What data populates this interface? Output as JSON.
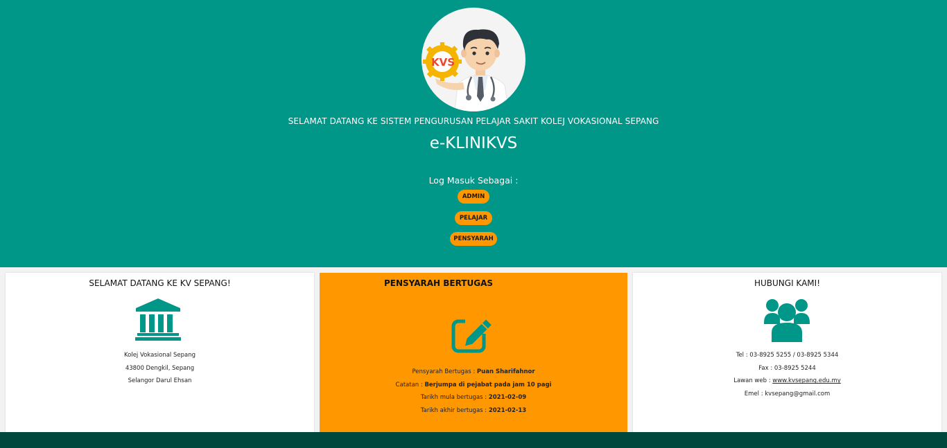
{
  "hero": {
    "tagline": "SELAMAT DATANG KE SISTEM PENGURUSAN PELAJAR SAKIT KOLEJ VOKASIONAL SEPANG",
    "title": "e-KLINIKVS",
    "login_label": "Log Masuk Sebagai :",
    "logo_text": "KVS",
    "roles": [
      "ADMIN",
      "PELAJAR",
      "PENSYARAH"
    ]
  },
  "card_left": {
    "title": "SELAMAT DATANG KE KV SEPANG!",
    "icon": "institution-icon",
    "lines": [
      "Kolej Vokasional Sepang",
      "43800 Dengkil, Sepang",
      "Selangor Darul Ehsan"
    ]
  },
  "card_mid": {
    "title": "PENSYARAH BERTUGAS",
    "icon": "edit-icon",
    "lecturer_label": "Pensyarah Bertugas : ",
    "lecturer_value": "Puan Sharifahnor",
    "note_label": "Catatan : ",
    "note_value": "Berjumpa di pejabat pada jam 10 pagi",
    "start_label": "Tarikh mula bertugas : ",
    "start_value": "2021-02-09",
    "end_label": "Tarikh akhir bertugas : ",
    "end_value": "2021-02-13"
  },
  "card_right": {
    "title": "HUBUNGI KAMI!",
    "icon": "users-icon",
    "tel": "Tel : 03-8925 5255 / 03-8925 5344",
    "fax": "Fax : 03-8925 5244",
    "web_label": "Lawan web : ",
    "web_link": "www.kvsepang.edu.my",
    "email": "Emel : kvsepang@gmail.com"
  },
  "colors": {
    "primary": "#009688",
    "accent": "#ff9800",
    "footer": "#00473d"
  }
}
